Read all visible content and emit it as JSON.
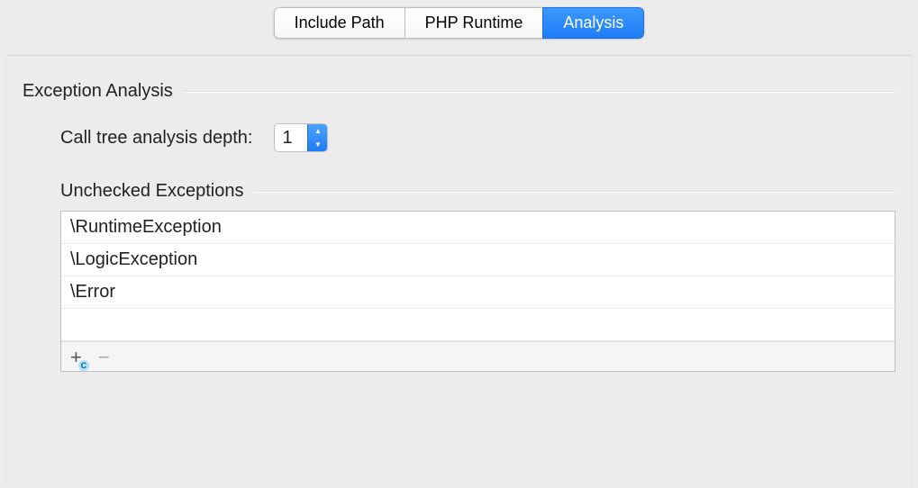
{
  "tabs": [
    {
      "label": "Include Path",
      "active": false
    },
    {
      "label": "PHP Runtime",
      "active": false
    },
    {
      "label": "Analysis",
      "active": true
    }
  ],
  "section": {
    "title": "Exception Analysis",
    "depth_label": "Call tree analysis depth:",
    "depth_value": "1",
    "unchecked_title": "Unchecked Exceptions",
    "unchecked_items": [
      "\\RuntimeException",
      "\\LogicException",
      "\\Error"
    ]
  }
}
